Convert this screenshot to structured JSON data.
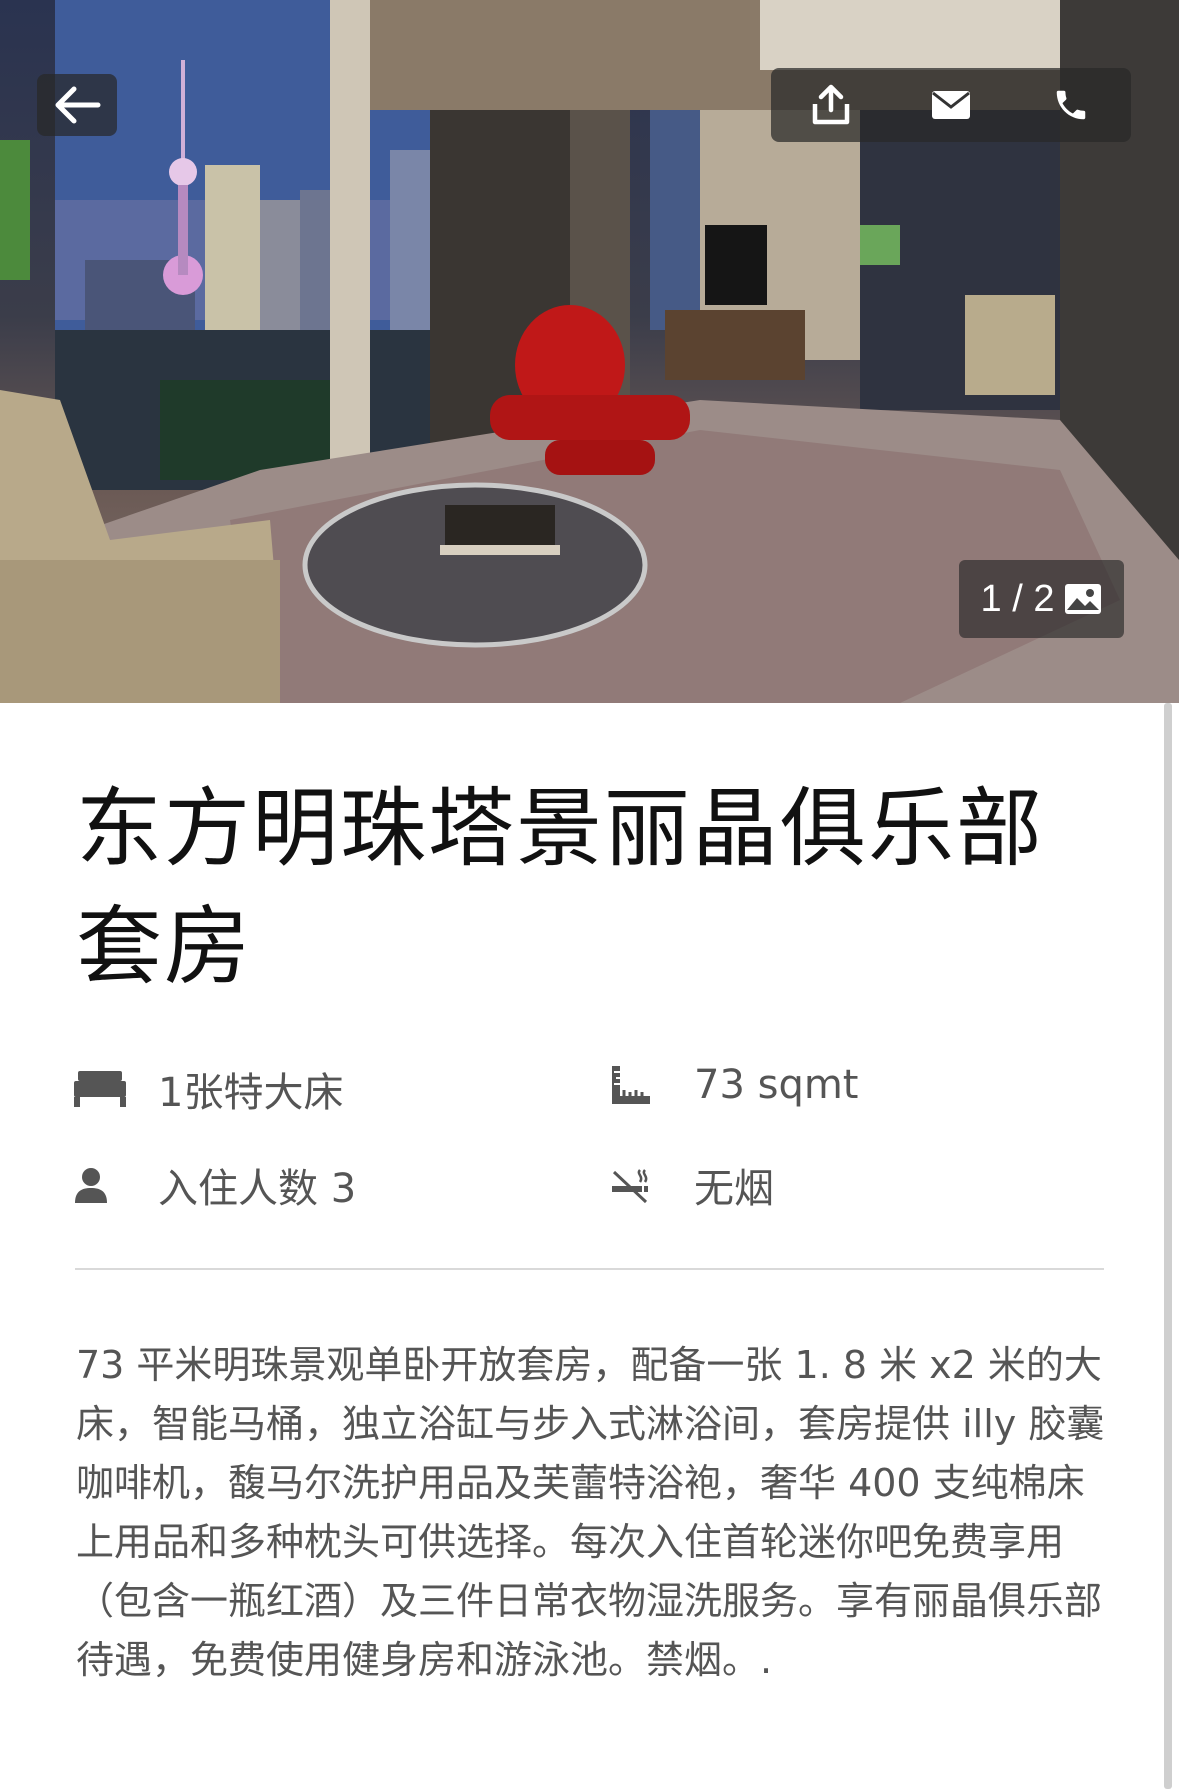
{
  "gallery": {
    "counter_text": "1 / 2",
    "back_icon": "arrow-left-icon",
    "share_icon": "share-icon",
    "mail_icon": "mail-icon",
    "phone_icon": "phone-icon",
    "gallery_icon": "image-icon"
  },
  "room": {
    "title": "东方明珠塔景丽晶俱乐部套房",
    "amenities": {
      "bed": "1张特大床",
      "area": "73 sqmt",
      "guests": "入住人数 3",
      "smoking": "无烟"
    },
    "description": "73 平米明珠景观单卧开放套房，配备一张 1. 8 米 x2 米的大床，智能马桶，独立浴缸与步入式淋浴间，套房提供 illy 胶囊咖啡机，馥马尔洗护用品及芙蕾特浴袍，奢华 400 支纯棉床上用品和多种枕头可供选择。每次入住首轮迷你吧免费享用（包含一瓶红酒）及三件日常衣物湿洗服务。享有丽晶俱乐部待遇，免费使用健身房和游泳池。禁烟。."
  }
}
